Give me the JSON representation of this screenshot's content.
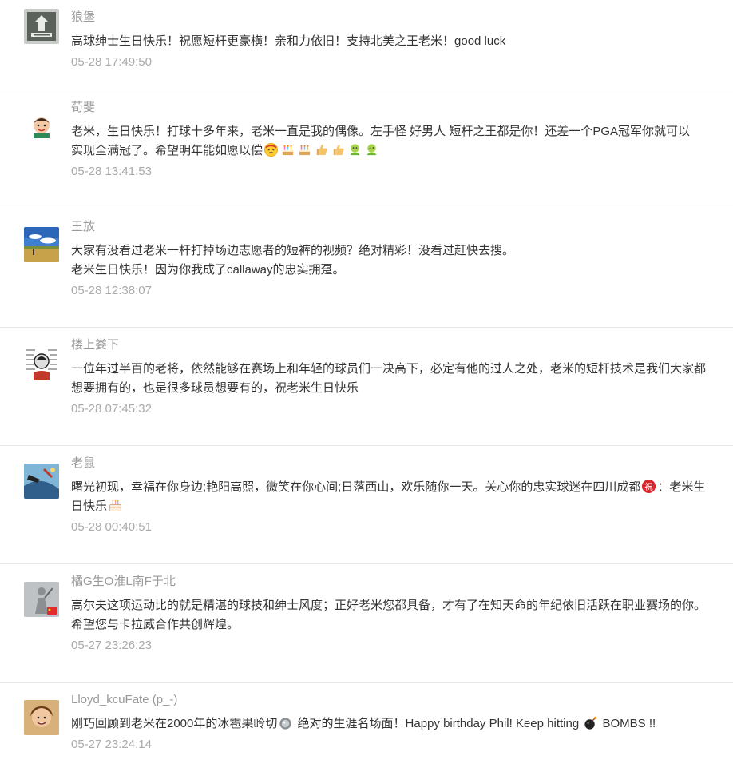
{
  "comments": [
    {
      "author": "狼堡",
      "avatar": "avatar-logo-dark",
      "lines": [
        "高球绅士生日快乐！祝愿短杆更豪横！亲和力依旧！支持北美之王老米！good luck"
      ],
      "time": "05-28 17:49:50"
    },
    {
      "author": "荀斐",
      "avatar": "avatar-cartoon-face",
      "line1": "老米，生日快乐！打球十多年来，老米一直是我的偶像。左手怪  好男人  短杆之王都是你！还差一个PGA冠军你就可以",
      "line2": "实现全满冠了。希望明年能如愿以偿",
      "emojis": [
        "dizzy-face-icon",
        "cake-icon",
        "cake-icon",
        "thumbs-up-icon",
        "thumbs-up-icon",
        "lucky-icon",
        "lucky-icon"
      ],
      "time": "05-28 13:41:53"
    },
    {
      "author": "王放",
      "avatar": "avatar-landscape",
      "lines": [
        "大家有没看过老米一杆打掉场边志愿者的短裤的视频？绝对精彩！没看过赶快去搜。",
        "老米生日快乐！因为你我成了callaway的忠实拥趸。"
      ],
      "time": "05-28 12:38:07"
    },
    {
      "author": "楼上娄下",
      "avatar": "avatar-sketch",
      "lines": [
        "一位年过半百的老将，依然能够在赛场上和年轻的球员们一决高下，必定有他的过人之处，老米的短杆技术是我们大家都",
        "想要拥有的，也是很多球员想要有的，祝老米生日快乐"
      ],
      "time": "05-28 07:45:32"
    },
    {
      "author": "老鼠",
      "avatar": "avatar-illustration",
      "line1_a": "曙光初现，幸福在你身边;艳阳高照，微笑在你心间;日落西山，欢乐随你一天。关心你的忠实球迷在四川成都",
      "line1_b": "：老米生",
      "line2": "日快乐",
      "time": "05-28 00:40:51"
    },
    {
      "author": "橘G生O淮L南F于北",
      "avatar": "avatar-golfer-flag",
      "lines": [
        "高尔夫这项运动比的就是精湛的球技和绅士风度；正好老米您都具备，才有了在知天命的年纪依旧活跃在职业赛场的你。",
        "希望您与卡拉威合作共创辉煌。"
      ],
      "time": "05-27 23:26:23"
    },
    {
      "author": "Lloyd_kcuFate (p_-)",
      "avatar": "avatar-portrait",
      "line1_a": "刚巧回顾到老米在2000年的冰雹果岭切",
      "line1_b": " 绝对的生涯名场面！Happy birthday Phil! Keep hitting ",
      "line1_c": " BOMBS !!",
      "time": "05-27 23:24:14"
    }
  ],
  "colors": {
    "author": "#999999",
    "text": "#333333",
    "time": "#aaaaaa",
    "divider": "#e6e6e6"
  }
}
